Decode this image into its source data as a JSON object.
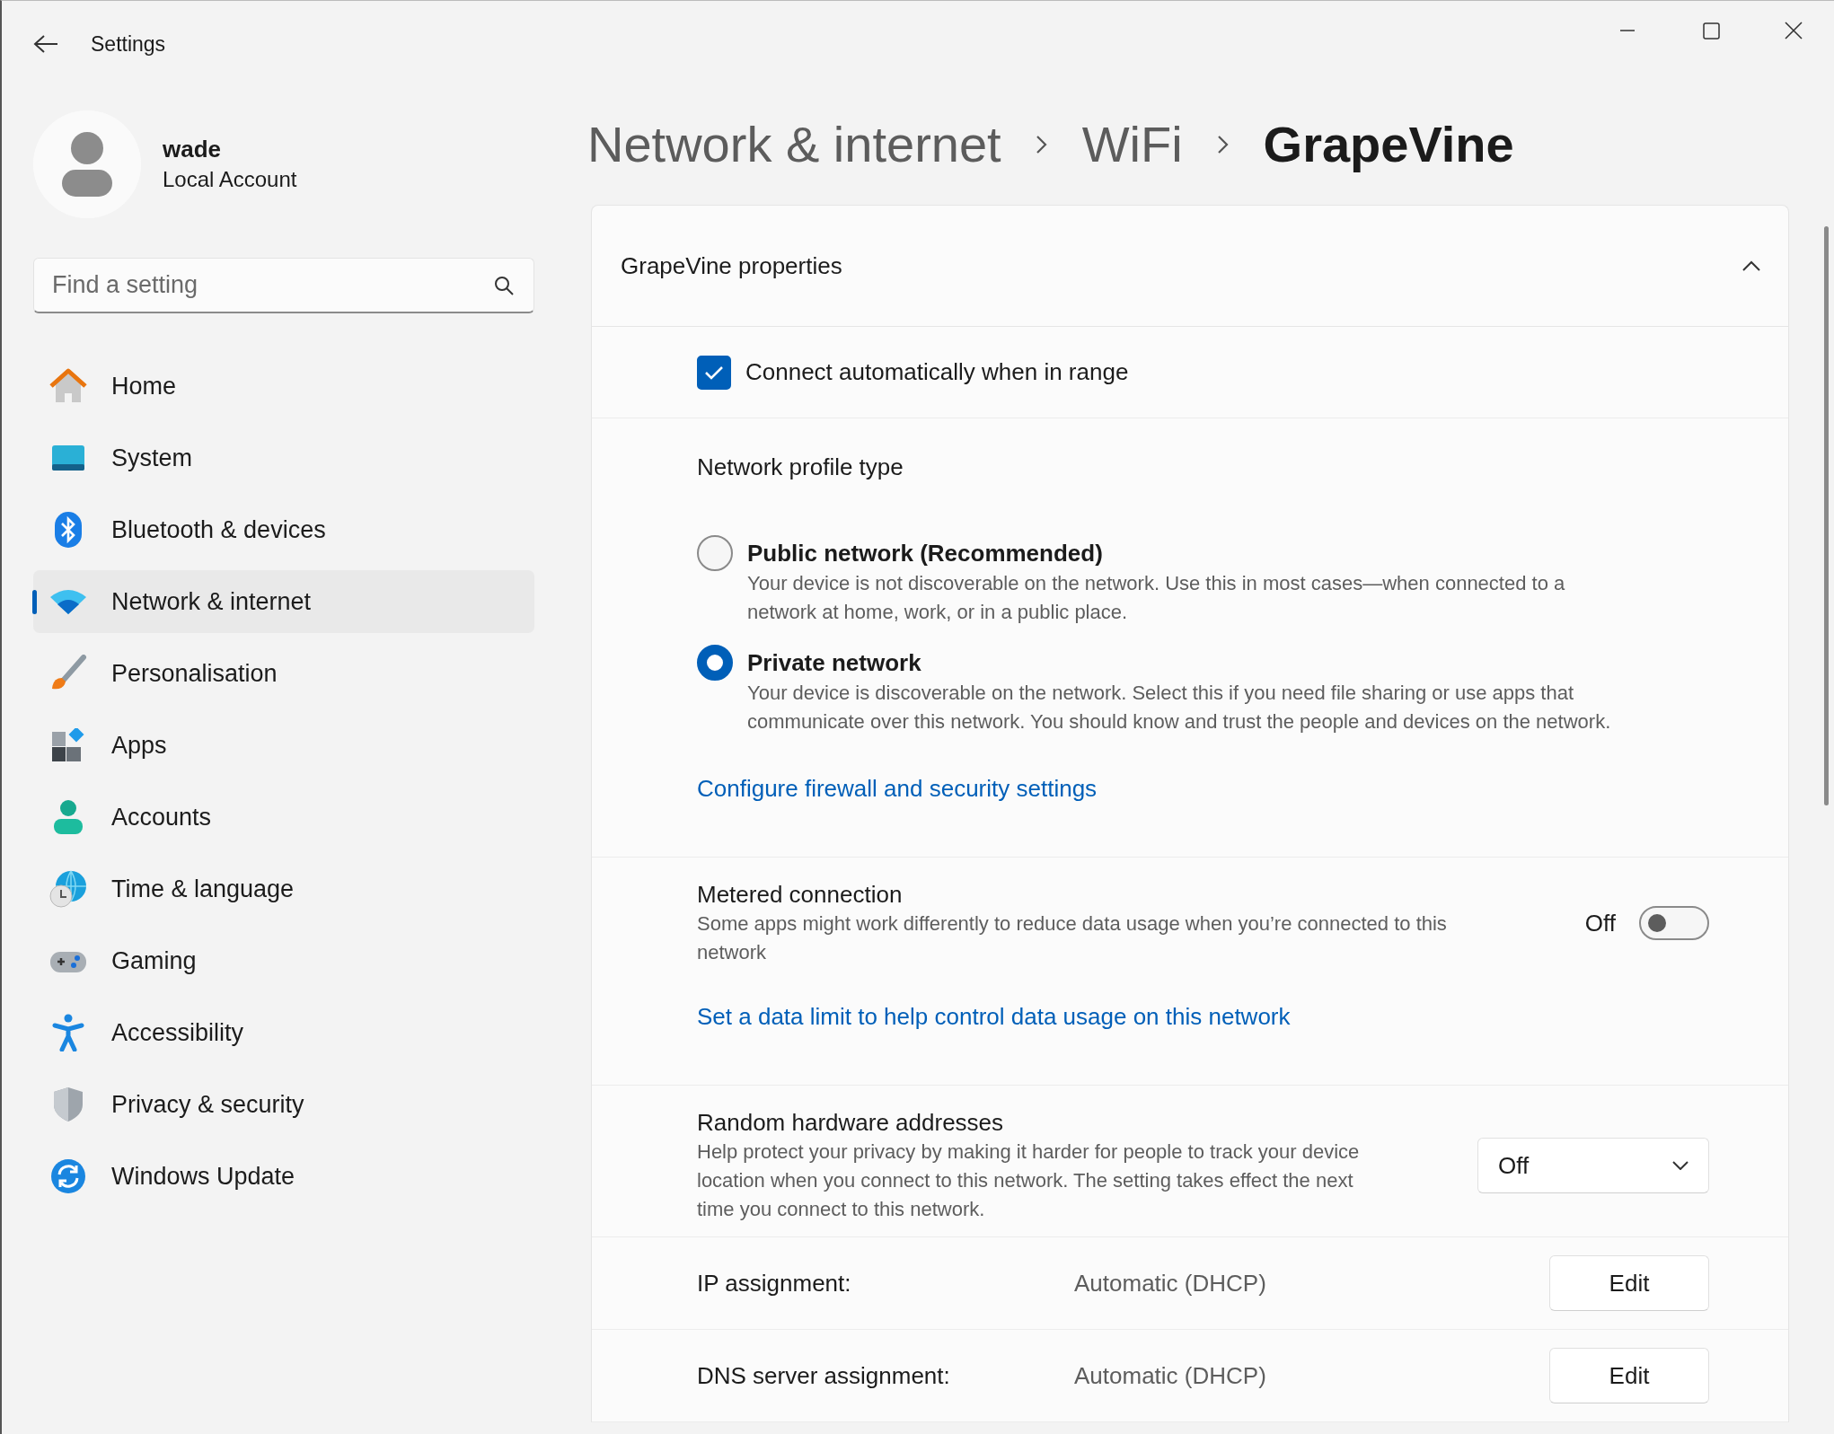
{
  "window": {
    "title": "Settings"
  },
  "account": {
    "name": "wade",
    "type": "Local Account"
  },
  "search": {
    "placeholder": "Find a setting"
  },
  "sidebar": {
    "items": [
      {
        "label": "Home",
        "selected": false
      },
      {
        "label": "System",
        "selected": false
      },
      {
        "label": "Bluetooth & devices",
        "selected": false
      },
      {
        "label": "Network & internet",
        "selected": true
      },
      {
        "label": "Personalisation",
        "selected": false
      },
      {
        "label": "Apps",
        "selected": false
      },
      {
        "label": "Accounts",
        "selected": false
      },
      {
        "label": "Time & language",
        "selected": false
      },
      {
        "label": "Gaming",
        "selected": false
      },
      {
        "label": "Accessibility",
        "selected": false
      },
      {
        "label": "Privacy & security",
        "selected": false
      },
      {
        "label": "Windows Update",
        "selected": false
      }
    ]
  },
  "breadcrumb": [
    {
      "label": "Network & internet",
      "selected": false
    },
    {
      "label": "WiFi",
      "selected": false
    },
    {
      "label": "GrapeVine",
      "selected": true
    }
  ],
  "properties": {
    "title": "GrapeVine properties",
    "expanded": true,
    "connect_automatically": {
      "label": "Connect automatically when in range",
      "checked": true
    },
    "profile": {
      "heading": "Network profile type",
      "options": [
        {
          "label": "Public network (Recommended)",
          "description": "Your device is not discoverable on the network. Use this in most cases—when connected to a network at home, work, or in a public place.",
          "selected": false
        },
        {
          "label": "Private network",
          "description": "Your device is discoverable on the network. Select this if you need file sharing or use apps that communicate over this network. You should know and trust the people and devices on the network.",
          "selected": true
        }
      ],
      "link": "Configure firewall and security settings"
    },
    "metered": {
      "title": "Metered connection",
      "description": "Some apps might work differently to reduce data usage when you’re connected to this network",
      "state_text": "Off",
      "on": false,
      "link": "Set a data limit to help control data usage on this network"
    },
    "random_hardware": {
      "title": "Random hardware addresses",
      "description": "Help protect your privacy by making it harder for people to track your device location when you connect to this network. The setting takes effect the next time you connect to this network.",
      "value": "Off"
    },
    "assignments": [
      {
        "label": "IP assignment:",
        "value": "Automatic (DHCP)",
        "button": "Edit"
      },
      {
        "label": "DNS server assignment:",
        "value": "Automatic (DHCP)",
        "button": "Edit"
      }
    ]
  }
}
